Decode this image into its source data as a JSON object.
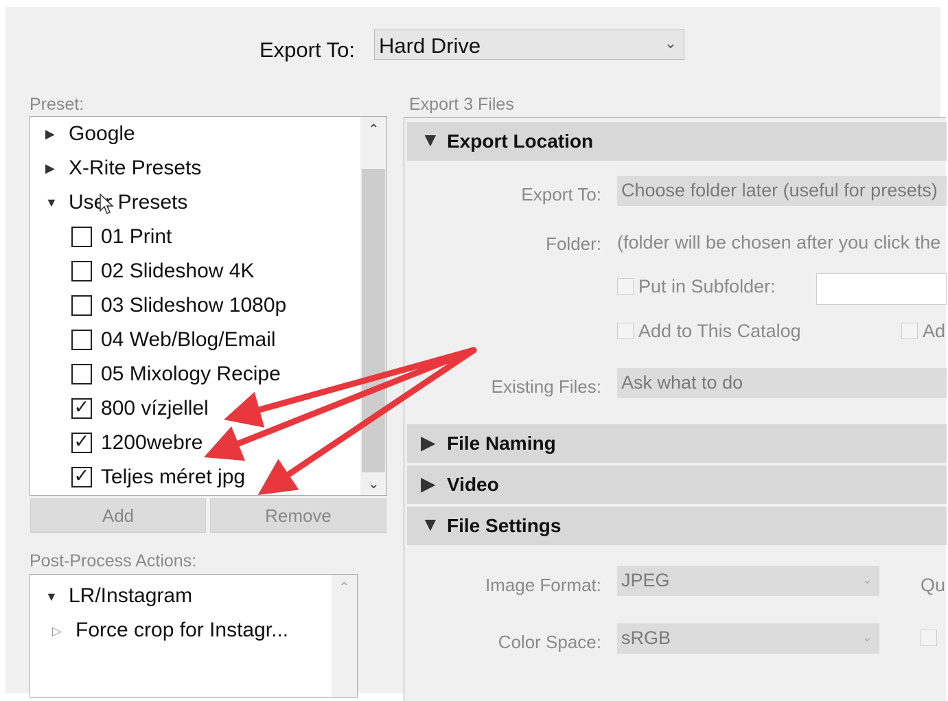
{
  "header": {
    "export_to_label": "Export To:",
    "export_to_value": "Hard Drive"
  },
  "preset": {
    "label": "Preset:",
    "items": [
      {
        "label": "Google",
        "type": "folder",
        "expanded": false
      },
      {
        "label": "X-Rite Presets",
        "type": "folder",
        "expanded": false
      },
      {
        "label": "User Presets",
        "type": "folder",
        "expanded": true
      },
      {
        "label": "01 Print",
        "type": "check",
        "checked": false
      },
      {
        "label": "02 Slideshow 4K",
        "type": "check",
        "checked": false
      },
      {
        "label": "03 Slideshow 1080p",
        "type": "check",
        "checked": false
      },
      {
        "label": "04 Web/Blog/Email",
        "type": "check",
        "checked": false
      },
      {
        "label": "05 Mixology Recipe",
        "type": "check",
        "checked": false
      },
      {
        "label": "800 vízjellel",
        "type": "check",
        "checked": true
      },
      {
        "label": "1200webre",
        "type": "check",
        "checked": true
      },
      {
        "label": "Teljes méret jpg",
        "type": "check",
        "checked": true
      }
    ],
    "add_label": "Add",
    "remove_label": "Remove"
  },
  "post_process": {
    "label": "Post-Process Actions:",
    "group": "LR/Instagram",
    "item": "Force crop for Instagr..."
  },
  "export": {
    "title": "Export 3 Files",
    "location": {
      "title": "Export Location",
      "export_to_label": "Export To:",
      "export_to_value": "Choose folder later (useful for presets)",
      "folder_label": "Folder:",
      "folder_value": "(folder will be chosen after you click the",
      "subfolder_label": "Put in Subfolder:",
      "catalog_label": "Add to This Catalog",
      "catalog_extra": "Ad",
      "existing_label": "Existing Files:",
      "existing_value": "Ask what to do"
    },
    "file_naming_title": "File Naming",
    "video_title": "Video",
    "file_settings": {
      "title": "File Settings",
      "format_label": "Image Format:",
      "format_value": "JPEG",
      "quality_label_partial": "Qu",
      "color_label": "Color Space:",
      "color_value": "sRGB"
    }
  },
  "colors": {
    "arrow": "#e8383d",
    "panel_bg": "#f0f0f0",
    "section_header": "#d8d8d8"
  }
}
